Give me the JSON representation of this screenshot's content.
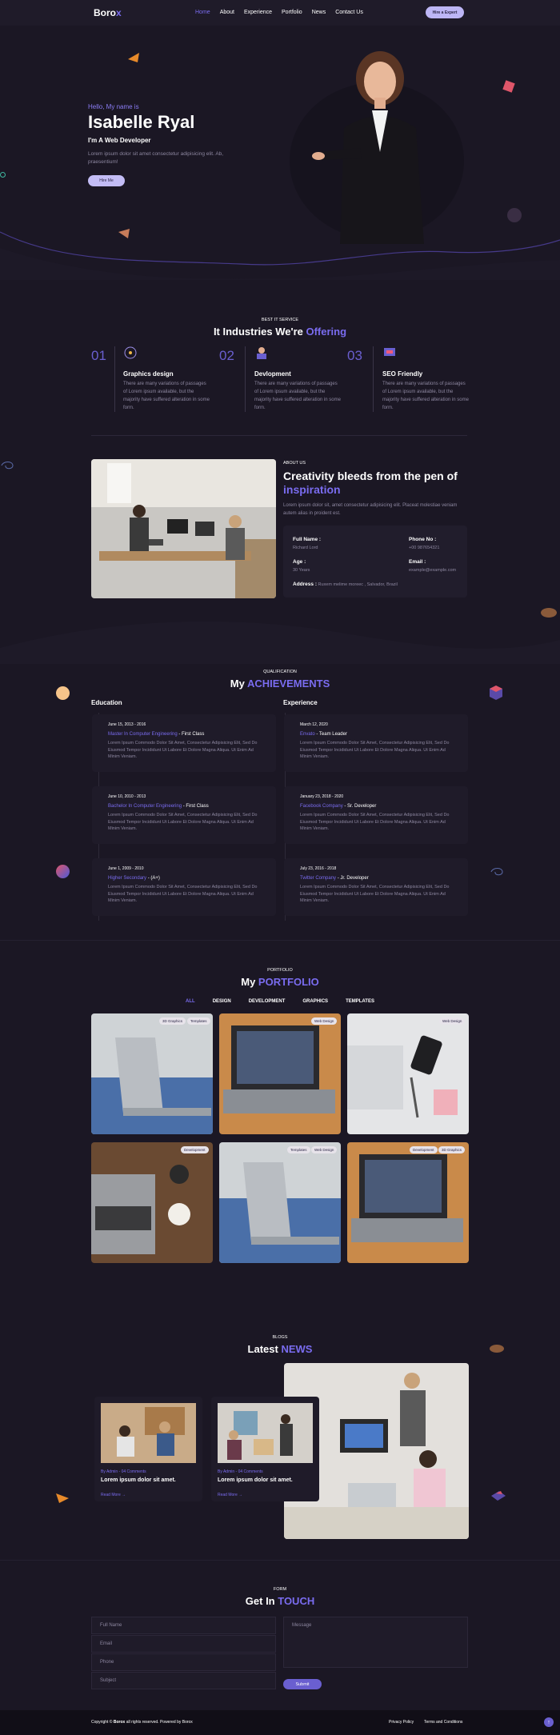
{
  "brand": {
    "prefix": "Boro",
    "suffix": "x"
  },
  "nav": {
    "items": [
      "Home",
      "About",
      "Experience",
      "Portfolio",
      "News",
      "Contact Us"
    ],
    "hire": "Hire a Expert",
    "accent": "#7a6cf0"
  },
  "hero": {
    "hello": "Hello, My name is",
    "name": "Isabelle Ryal",
    "role": "I'm A Web Developer",
    "desc": "Lorem ipsum dolor sit amet consectetur adipisicing elit. Ab, praesentium!",
    "button": "Hire Me"
  },
  "services": {
    "subtitle": "BEST IT SERVICE",
    "title_pre": "It Industries We're ",
    "title_accent": "Offering",
    "items": [
      {
        "num": "01",
        "title": "Graphics design",
        "text": "There are many variations of passages of Lorem ipsum available, but the majority have suffered alteration in some form."
      },
      {
        "num": "02",
        "title": "Devlopment",
        "text": "There are many variations of passages of Lorem ipsum available, but the majority have suffered alteration in some form."
      },
      {
        "num": "03",
        "title": "SEO Friendly",
        "text": "There are many variations of passages of Lorem ipsum available, but the majority have suffered alteration in some form."
      }
    ]
  },
  "about": {
    "subtitle": "ABOUT US",
    "title_pre": "Creativity bleeds from the pen of",
    "title_accent": "inspiration",
    "desc": "Lorem ipsum dolor sit, amet consectetur adipisicing elit. Placeat molestiae veniam autem alias in proident est.",
    "fullname_label": "Full Name :",
    "fullname": "Richard Lord",
    "phone_label": "Phone No :",
    "phone": "+00 987654321",
    "age_label": "Age :",
    "age": "30 Years",
    "email_label": "Email :",
    "email": "example@example.com",
    "address_label": "Address :",
    "address": "Ruxem melime moreec , Salvador, Brazil"
  },
  "achievements": {
    "subtitle": "QUALIFICATION",
    "title_pre": "My ",
    "title_accent": "ACHIEVEMENTS",
    "education_label": "Education",
    "experience_label": "Experience",
    "education": [
      {
        "date": "June 15, 2013 - 2016",
        "title": "Master In Computer Engineering",
        "extra": "- First Class",
        "text": "Lorem Ipsum Commodo Dolor Sit Amet, Consectetur Adipisicing Elit, Sed Do Eiusmod Tempor Incididunt Ut Labore Et Dolore Magna Aliqua. Ut Enim Ad Minim Veniam."
      },
      {
        "date": "June 10, 2010 - 2013",
        "title": "Bachelor In Computer Engineering",
        "extra": "- First Class",
        "text": "Lorem Ipsum Commodo Dolor Sit Amet, Consectetur Adipisicing Elit, Sed Do Eiusmod Tempor Incididunt Ut Labore Et Dolore Magna Aliqua. Ut Enim Ad Minim Veniam."
      },
      {
        "date": "June 1, 2009 - 2010",
        "title": "Higher Secondary",
        "extra": "- (A+)",
        "text": "Lorem Ipsum Commodo Dolor Sit Amet, Consectetur Adipisicing Elit, Sed Do Eiusmod Tempor Incididunt Ut Labore Et Dolore Magna Aliqua. Ut Enim Ad Minim Veniam."
      }
    ],
    "experience": [
      {
        "date": "March 12, 2020",
        "title": "Envato",
        "extra": "- Team Leader",
        "text": "Lorem Ipsum Commodo Dolor Sit Amet, Consectetur Adipisicing Elit, Sed Do Eiusmod Tempor Incididunt Ut Labore Et Dolore Magna Aliqua. Ut Enim Ad Minim Veniam."
      },
      {
        "date": "January 23, 2018 - 2020",
        "title": "Facebook Company",
        "extra": "- Sr. Developer",
        "text": "Lorem Ipsum Commodo Dolor Sit Amet, Consectetur Adipisicing Elit, Sed Do Eiusmod Tempor Incididunt Ut Labore Et Dolore Magna Aliqua. Ut Enim Ad Minim Veniam."
      },
      {
        "date": "July 23, 2016 - 2018",
        "title": "Twitter Company",
        "extra": "- Jr. Developer",
        "text": "Lorem Ipsum Commodo Dolor Sit Amet, Consectetur Adipisicing Elit, Sed Do Eiusmod Tempor Incididunt Ut Labore Et Dolore Magna Aliqua. Ut Enim Ad Minim Veniam."
      }
    ]
  },
  "portfolio": {
    "subtitle": "PORTFOLIO",
    "title_pre": "My ",
    "title_accent": "PORTFOLIO",
    "filters": [
      "ALL",
      "DESIGN",
      "DEVELOPMENT",
      "GRAPHICS",
      "TEMPLATES"
    ],
    "items": [
      {
        "tags": [
          "3D Graphics",
          "Templates"
        ]
      },
      {
        "tags": [
          "Web Design"
        ]
      },
      {
        "tags": [
          "Web Design"
        ]
      },
      {
        "tags": [
          "Development"
        ]
      },
      {
        "tags": [
          "Templates",
          "Web Design"
        ]
      },
      {
        "tags": [
          "Development",
          "3D Graphics"
        ]
      }
    ]
  },
  "news": {
    "subtitle": "BLOGS",
    "title_pre": "Latest ",
    "title_accent": "NEWS",
    "posts": [
      {
        "meta": "By Admin - 04 Comments",
        "title": "Lorem ipsum dolor sit amet.",
        "more": "Read More"
      },
      {
        "meta": "By Admin - 04 Comments",
        "title": "Lorem ipsum dolor sit amet.",
        "more": "Read More"
      }
    ]
  },
  "contact": {
    "subtitle": "FORM",
    "title_pre": "Get In ",
    "title_accent": "TOUCH",
    "fields": {
      "name": "Full Name",
      "email": "Email",
      "phone": "Phone",
      "subject": "Subject",
      "message": "Message"
    },
    "submit": "Submit"
  },
  "footer": {
    "copyright_pre": "Copyright © ",
    "copyright_brand": "Borox",
    "copyright_post": " all rights reserved. Powered by Borox",
    "links": [
      "Privacy Policy",
      "Terms and Conditions"
    ]
  }
}
